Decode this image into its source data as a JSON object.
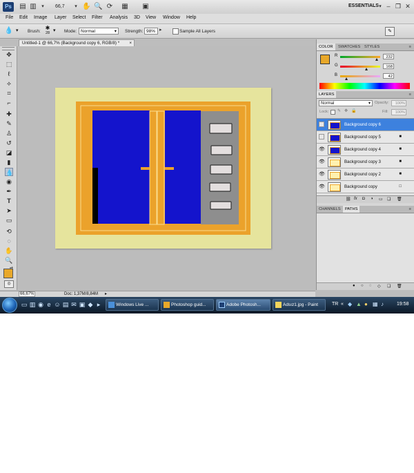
{
  "appbar": {
    "logo": "Ps",
    "zoom": "66,7",
    "workspace": "ESSENTIALS",
    "icons": [
      "bridge-icon",
      "minibridge-icon",
      "zoom-dropdown-icon",
      "hand-icon",
      "zoom-icon",
      "rotate-icon",
      "arrange-icon",
      "screen-mode-icon"
    ]
  },
  "menu": [
    "File",
    "Edit",
    "Image",
    "Layer",
    "Select",
    "Filter",
    "Analysis",
    "3D",
    "View",
    "Window",
    "Help"
  ],
  "options": {
    "brush_label": "Brush:",
    "brush_size": "28",
    "mode_label": "Mode:",
    "mode_value": "Normal",
    "strength_label": "Strength:",
    "strength_value": "98%",
    "sample_all_label": "Sample All Layers"
  },
  "document": {
    "tab_title": "Untitled-1 @ 66,7% (Background copy 6, RGB/8) *",
    "close": "×"
  },
  "status": {
    "zoom": "66,67%",
    "doc_info": "Doc: 1,37M/8,84M"
  },
  "color_panel": {
    "tabs": [
      "COLOR",
      "SWATCHES",
      "STYLES"
    ],
    "channels": [
      {
        "label": "R",
        "value": "232",
        "fraction": 0.91
      },
      {
        "label": "G",
        "value": "168",
        "fraction": 0.66
      },
      {
        "label": "B",
        "value": "42",
        "fraction": 0.16
      }
    ],
    "foreground": "#e8a82a"
  },
  "layers_panel": {
    "tab": "LAYERS",
    "blend_mode": "Normal",
    "opacity_label": "Opacity:",
    "opacity_value": "100%",
    "lock_label": "Lock:",
    "fill_label": "Fill:",
    "fill_value": "100%",
    "layers": [
      {
        "name": "Background copy 6",
        "visible": false,
        "selected": true,
        "lock": ""
      },
      {
        "name": "Background copy 5",
        "visible": false,
        "selected": false,
        "lock": "🔒"
      },
      {
        "name": "Background copy 4",
        "visible": true,
        "selected": false,
        "lock": "🔒"
      },
      {
        "name": "Background copy 3",
        "visible": true,
        "selected": false,
        "lock": "🔒"
      },
      {
        "name": "Background copy 2",
        "visible": true,
        "selected": false,
        "lock": "🔒"
      },
      {
        "name": "Background copy",
        "visible": true,
        "selected": false,
        "lock": "🔓"
      }
    ],
    "footer_icons": [
      "link-icon",
      "fx-icon",
      "mask-icon",
      "adjustment-icon",
      "folder-icon",
      "new-layer-icon",
      "trash-icon"
    ]
  },
  "channels_panel": {
    "tabs": [
      "CHANNELS",
      "PATHS"
    ]
  },
  "taskbar": {
    "buttons": [
      {
        "label": "Windows Live ...",
        "active": false,
        "icon_color": "#4a90d9"
      },
      {
        "label": "Photoshop guid...",
        "active": false,
        "icon_color": "#e8a82a"
      },
      {
        "label": "Adobe Photosh...",
        "active": true,
        "icon_color": "#1d3f73"
      },
      {
        "label": "Adsız1.jpg - Paint",
        "active": false,
        "icon_color": "#f2d45c"
      }
    ],
    "lang": "TR",
    "time": "19:58"
  },
  "colors": {
    "artboard": "#e6e49d",
    "frame_orange": "#eba22b",
    "glass_blue": "#1414cc",
    "panel_gray": "#8e8e8e",
    "selection_blue": "#3d81de"
  }
}
